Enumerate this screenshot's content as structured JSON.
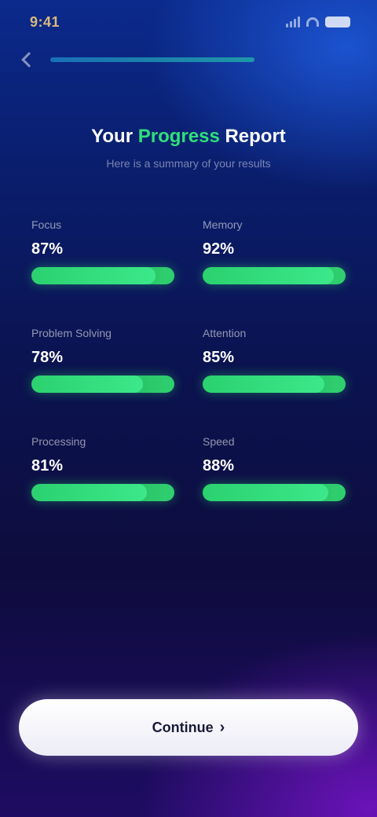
{
  "status_bar": {
    "time": "9:41",
    "icons": [
      "signal-icon",
      "wifi-icon",
      "battery-icon"
    ]
  },
  "nav": {
    "progress": 0.65
  },
  "heading": {
    "prefix": "Your",
    "highlight": "Progress",
    "suffix": "Report",
    "subtitle": "Here is a summary of your results"
  },
  "stats": [
    {
      "label": "Focus",
      "value": "87%",
      "level": 0.87
    },
    {
      "label": "Memory",
      "value": "92%",
      "level": 0.92
    },
    {
      "label": "Problem Solving",
      "value": "78%",
      "level": 0.78
    },
    {
      "label": "Attention",
      "value": "85%",
      "level": 0.85
    },
    {
      "label": "Processing",
      "value": "81%",
      "level": 0.81
    },
    {
      "label": "Speed",
      "value": "88%",
      "level": 0.88
    }
  ],
  "cta": {
    "label": "Continue",
    "icon": "arrow-right-icon"
  },
  "colors": {
    "accent": "#2ee07a",
    "background_top": "#0b2a8c",
    "background_bottom": "#1e0c62"
  }
}
